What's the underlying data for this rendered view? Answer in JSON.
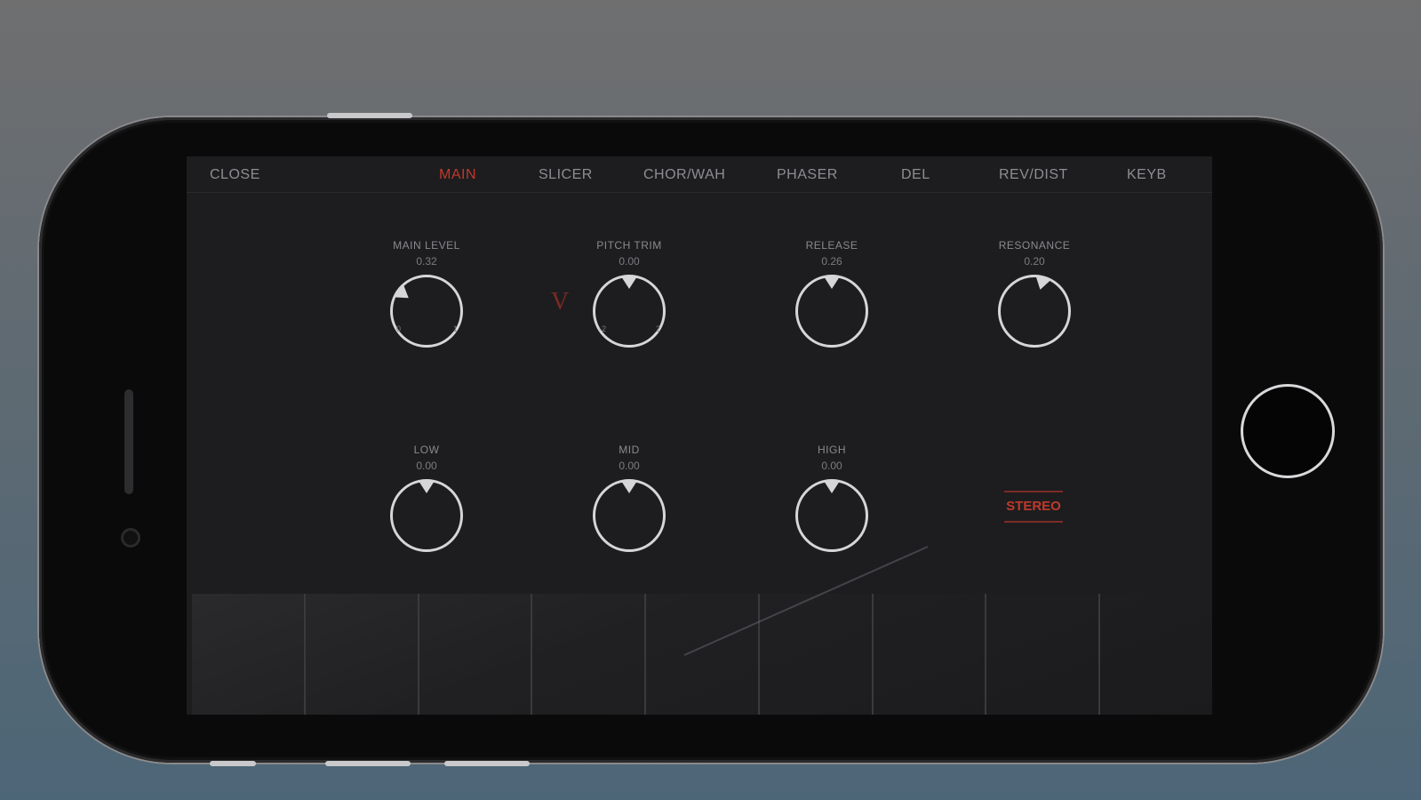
{
  "tabs": [
    {
      "label": "CLOSE",
      "active": false
    },
    {
      "label": "MAIN",
      "active": true
    },
    {
      "label": "SLICER",
      "active": false
    },
    {
      "label": "CHOR/WAH",
      "active": false
    },
    {
      "label": "PHASER",
      "active": false
    },
    {
      "label": "DEL",
      "active": false
    },
    {
      "label": "REV/DIST",
      "active": false
    },
    {
      "label": "KEYB",
      "active": false
    }
  ],
  "knobs": [
    {
      "label": "MAIN LEVEL",
      "value": "0.32",
      "min": "0",
      "max": "1",
      "level": 0.32
    },
    {
      "label": "PITCH TRIM",
      "value": "0.00",
      "min": "-2",
      "max": "2",
      "level": 0.5
    },
    {
      "label": "RELEASE",
      "value": "0.26",
      "level": 0.5
    },
    {
      "label": "RESONANCE",
      "value": "0.20",
      "level": 0.55
    },
    {
      "label": "LOW",
      "value": "0.00",
      "level": 0.5
    },
    {
      "label": "MID",
      "value": "0.00",
      "level": 0.5
    },
    {
      "label": "HIGH",
      "value": "0.00",
      "level": 0.5
    }
  ],
  "pitch_marker": "V",
  "stereo_label": "STEREO",
  "keyboard": {
    "white_keys": 9
  },
  "colors": {
    "accent": "#c0392b",
    "screen_bg": "#1d1d1f"
  }
}
